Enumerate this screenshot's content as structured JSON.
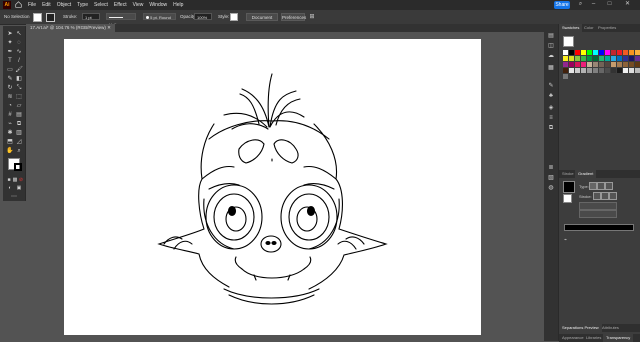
{
  "app": {
    "logo": "Ai"
  },
  "menu": [
    "File",
    "Edit",
    "Object",
    "Type",
    "Select",
    "Effect",
    "View",
    "Window",
    "Help"
  ],
  "share_label": "Share",
  "control_bar": {
    "selection": "No Selection",
    "stroke_label": "Stroke:",
    "stroke_weight": "1 pt",
    "stroke_style": "Uniform",
    "brush": "5 pt. Round",
    "opacity_label": "Opacity:",
    "opacity_value": "100%",
    "style_label": "Style:",
    "document_setup": "Document Setup",
    "preferences": "Preferences"
  },
  "document_tab": "17.Art.ai* @ 104.76 % (RGB/Preview)",
  "panels": {
    "top_tabs": [
      "Swatches",
      "Color",
      "Properties"
    ],
    "mid_tabs": [
      "Stroke",
      "Gradient"
    ],
    "gradient_type_label": "Type:",
    "gradient_stroke_label": "Stroke:",
    "bottom_tabs": [
      "Separations Preview",
      "Attributes"
    ],
    "bottom_tabs2": [
      "Appearance",
      "Libraries",
      "Transparency"
    ]
  },
  "colors": {
    "accent": "#1473e6",
    "swatches": [
      "#ffffff",
      "#000000",
      "#ff0000",
      "#ffff00",
      "#00ff00",
      "#00ffff",
      "#0000ff",
      "#ff00ff",
      "#c1272d",
      "#ed1c24",
      "#f15a24",
      "#f7931e",
      "#fbb03b",
      "#fcee21",
      "#d9e021",
      "#8cc63f",
      "#39b54a",
      "#009245",
      "#006837",
      "#22b573",
      "#00a99d",
      "#29abe2",
      "#0071bc",
      "#2e3192",
      "#1b1464",
      "#662d91",
      "#93278f",
      "#9e005d",
      "#d4145a",
      "#ed1e79",
      "#c7b299",
      "#998675",
      "#736357",
      "#534741",
      "#c69c6d",
      "#a67c52",
      "#8c6239",
      "#754c24",
      "#603813",
      "#42210b",
      "#e6e6e6",
      "#cccccc",
      "#b3b3b3",
      "#999999",
      "#808080",
      "#666666",
      "#4d4d4d",
      "#333333",
      "#1a1a1a",
      "#f2f2f2",
      "#dddddd",
      "#bbbbbb",
      "#777777"
    ]
  }
}
